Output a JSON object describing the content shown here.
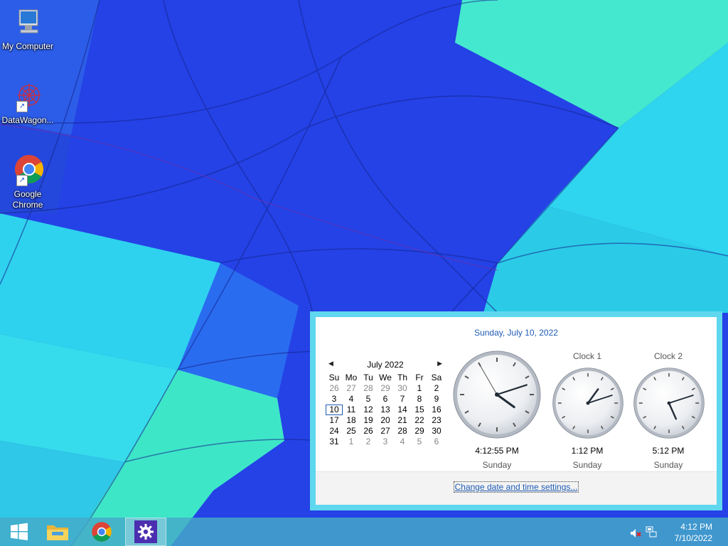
{
  "desktop": {
    "icons": [
      {
        "label": "My Computer",
        "icon": "computer-icon"
      },
      {
        "label": "DataWagon...",
        "icon": "datawagon-icon"
      },
      {
        "label": "Google Chrome",
        "icon": "chrome-icon"
      }
    ]
  },
  "flyout": {
    "long_date": "Sunday, July 10, 2022",
    "calendar": {
      "month_label": "July 2022",
      "weekdays": [
        "Su",
        "Mo",
        "Tu",
        "We",
        "Th",
        "Fr",
        "Sa"
      ],
      "weeks": [
        [
          "26",
          "27",
          "28",
          "29",
          "30",
          "1",
          "2"
        ],
        [
          "3",
          "4",
          "5",
          "6",
          "7",
          "8",
          "9"
        ],
        [
          "10",
          "11",
          "12",
          "13",
          "14",
          "15",
          "16"
        ],
        [
          "17",
          "18",
          "19",
          "20",
          "21",
          "22",
          "23"
        ],
        [
          "24",
          "25",
          "26",
          "27",
          "28",
          "29",
          "30"
        ],
        [
          "31",
          "1",
          "2",
          "3",
          "4",
          "5",
          "6"
        ]
      ],
      "today": "10"
    },
    "clocks": [
      {
        "title": "",
        "time": "4:12:55 PM",
        "day": "Sunday",
        "hour": 4,
        "minute": 12,
        "second": 55
      },
      {
        "title": "Clock 1",
        "time": "1:12 PM",
        "day": "Sunday",
        "hour": 1,
        "minute": 12
      },
      {
        "title": "Clock 2",
        "time": "5:12 PM",
        "day": "Sunday",
        "hour": 5,
        "minute": 12
      }
    ],
    "settings_link": "Change date and time settings..."
  },
  "taskbar": {
    "buttons": [
      {
        "name": "start-button",
        "icon": "windows-logo-icon"
      },
      {
        "name": "file-explorer-button",
        "icon": "folder-icon"
      },
      {
        "name": "chrome-button",
        "icon": "chrome-icon"
      },
      {
        "name": "settings-button",
        "icon": "gear-icon"
      }
    ],
    "tray": {
      "time": "4:12 PM",
      "date": "7/10/2022",
      "icons": [
        "speaker-muted-icon",
        "network-icon"
      ]
    }
  },
  "colors": {
    "flyout_border": "#5fd7ee",
    "link": "#1e5bb5",
    "taskbar": "#46aac8"
  }
}
